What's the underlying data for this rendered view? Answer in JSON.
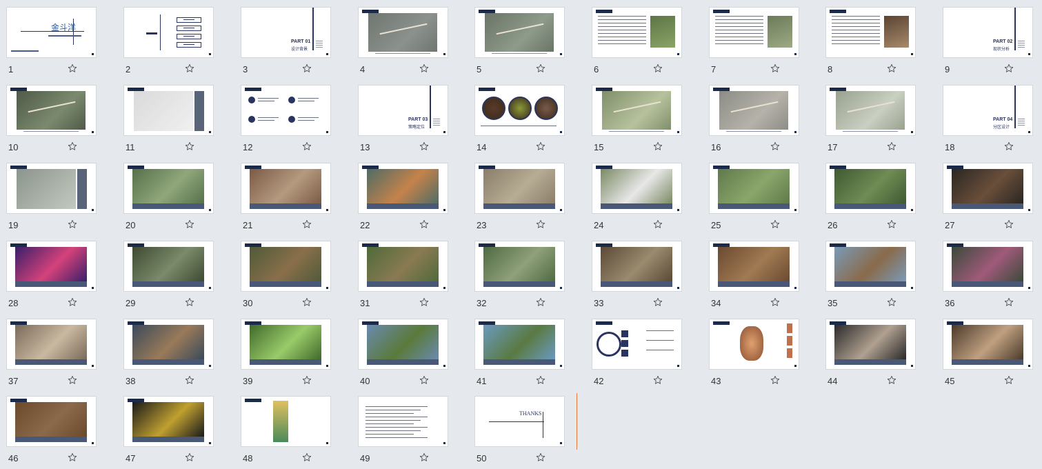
{
  "slides": [
    {
      "num": "1",
      "kind": "title",
      "title": "金斗洋"
    },
    {
      "num": "2",
      "kind": "toc"
    },
    {
      "num": "3",
      "kind": "part",
      "part": "PART 01",
      "sub": "设计背景"
    },
    {
      "num": "4",
      "kind": "map",
      "colors": [
        "#6f7670",
        "#8b918c"
      ]
    },
    {
      "num": "5",
      "kind": "map",
      "colors": [
        "#697466",
        "#8e9a8a"
      ]
    },
    {
      "num": "6",
      "kind": "textimg",
      "colors": [
        "#5d7445",
        "#8aa467"
      ]
    },
    {
      "num": "7",
      "kind": "textimg",
      "colors": [
        "#6b7a58",
        "#9eaa85"
      ]
    },
    {
      "num": "8",
      "kind": "textimg",
      "colors": [
        "#5a4333",
        "#a78a6a"
      ]
    },
    {
      "num": "9",
      "kind": "part",
      "part": "PART 02",
      "sub": "现状分析"
    },
    {
      "num": "10",
      "kind": "map",
      "colors": [
        "#4f5a48",
        "#7b8a6e"
      ]
    },
    {
      "num": "11",
      "kind": "plan",
      "colors": [
        "#dadada",
        "#f0f0f0"
      ]
    },
    {
      "num": "12",
      "kind": "swot"
    },
    {
      "num": "13",
      "kind": "part",
      "part": "PART 03",
      "sub": "策略定位"
    },
    {
      "num": "14",
      "kind": "circles"
    },
    {
      "num": "15",
      "kind": "map",
      "colors": [
        "#7f8f6a",
        "#b7c29d"
      ]
    },
    {
      "num": "16",
      "kind": "map",
      "colors": [
        "#8c8c86",
        "#b5b2aa"
      ]
    },
    {
      "num": "17",
      "kind": "map",
      "colors": [
        "#98a18e",
        "#c9cfc1"
      ]
    },
    {
      "num": "18",
      "kind": "part",
      "part": "PART 04",
      "sub": "分区设计"
    },
    {
      "num": "19",
      "kind": "plan",
      "colors": [
        "#8c958c",
        "#c2c9c0"
      ]
    },
    {
      "num": "20",
      "kind": "photo",
      "colors": [
        "#58704a",
        "#8fa77a"
      ]
    },
    {
      "num": "21",
      "kind": "photo",
      "colors": [
        "#7b5a46",
        "#b59a7f"
      ]
    },
    {
      "num": "22",
      "kind": "photo",
      "colors": [
        "#4f6c66",
        "#c5824a"
      ]
    },
    {
      "num": "23",
      "kind": "photo",
      "colors": [
        "#8a7e6a",
        "#b7ac94"
      ]
    },
    {
      "num": "24",
      "kind": "photo",
      "colors": [
        "#7a8a64",
        "#e8e8e8"
      ]
    },
    {
      "num": "25",
      "kind": "photo",
      "colors": [
        "#5f7a4a",
        "#8aa66a"
      ]
    },
    {
      "num": "26",
      "kind": "photo",
      "colors": [
        "#3f5a32",
        "#6f8c54"
      ]
    },
    {
      "num": "27",
      "kind": "photo",
      "colors": [
        "#2a2622",
        "#6a4f3a"
      ]
    },
    {
      "num": "28",
      "kind": "photo",
      "colors": [
        "#3a1f6a",
        "#d4427a"
      ]
    },
    {
      "num": "29",
      "kind": "photo",
      "colors": [
        "#3e4a32",
        "#7b8a6a"
      ]
    },
    {
      "num": "30",
      "kind": "photo",
      "colors": [
        "#4f5a3a",
        "#8a6f4a"
      ]
    },
    {
      "num": "31",
      "kind": "photo",
      "colors": [
        "#4f6a3a",
        "#8a7a52"
      ]
    },
    {
      "num": "32",
      "kind": "photo",
      "colors": [
        "#4f6a42",
        "#8fa07a"
      ]
    },
    {
      "num": "33",
      "kind": "photo",
      "colors": [
        "#5a4a36",
        "#9a8a6e"
      ]
    },
    {
      "num": "34",
      "kind": "photo",
      "colors": [
        "#6a4a30",
        "#a07a52"
      ]
    },
    {
      "num": "35",
      "kind": "photo",
      "colors": [
        "#7a9ab8",
        "#8a6a4a"
      ]
    },
    {
      "num": "36",
      "kind": "photo",
      "colors": [
        "#3a4a3a",
        "#a05a7a"
      ]
    },
    {
      "num": "37",
      "kind": "photo",
      "colors": [
        "#7a6a5a",
        "#c9b9a0"
      ]
    },
    {
      "num": "38",
      "kind": "photo",
      "colors": [
        "#3a4a5a",
        "#9a7a5a"
      ]
    },
    {
      "num": "39",
      "kind": "photo",
      "colors": [
        "#3f6a2a",
        "#9acb6a"
      ]
    },
    {
      "num": "40",
      "kind": "photo",
      "colors": [
        "#6a8ab0",
        "#5a7a3a"
      ]
    },
    {
      "num": "41",
      "kind": "photo",
      "colors": [
        "#6a9ac0",
        "#5a7a42"
      ]
    },
    {
      "num": "42",
      "kind": "ip"
    },
    {
      "num": "43",
      "kind": "ip2"
    },
    {
      "num": "44",
      "kind": "photo",
      "colors": [
        "#2a2a2a",
        "#b0a090"
      ]
    },
    {
      "num": "45",
      "kind": "photo",
      "colors": [
        "#4a3a2a",
        "#c0a080"
      ]
    },
    {
      "num": "46",
      "kind": "photo",
      "colors": [
        "#6a4a2a",
        "#8a6a4a"
      ]
    },
    {
      "num": "47",
      "kind": "photo",
      "colors": [
        "#1a1a1a",
        "#c0a030"
      ]
    },
    {
      "num": "48",
      "kind": "poster",
      "colors": [
        "#4a8a5a",
        "#e0c060"
      ]
    },
    {
      "num": "49",
      "kind": "text"
    },
    {
      "num": "50",
      "kind": "thanks",
      "title": "THANKS"
    }
  ],
  "accent": "#1c2a4a",
  "caption_color": "#4a5878",
  "cursor_color": "#e07a3a"
}
